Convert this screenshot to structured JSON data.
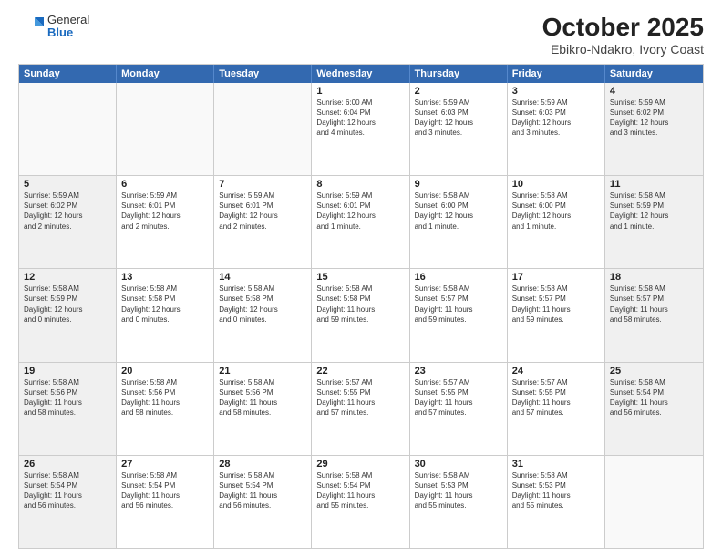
{
  "logo": {
    "general": "General",
    "blue": "Blue"
  },
  "title": "October 2025",
  "subtitle": "Ebikro-Ndakro, Ivory Coast",
  "header_days": [
    "Sunday",
    "Monday",
    "Tuesday",
    "Wednesday",
    "Thursday",
    "Friday",
    "Saturday"
  ],
  "weeks": [
    {
      "cells": [
        {
          "day": "",
          "empty": true
        },
        {
          "day": "",
          "empty": true
        },
        {
          "day": "",
          "empty": true
        },
        {
          "day": "1",
          "info": "Sunrise: 6:00 AM\nSunset: 6:04 PM\nDaylight: 12 hours\nand 4 minutes."
        },
        {
          "day": "2",
          "info": "Sunrise: 5:59 AM\nSunset: 6:03 PM\nDaylight: 12 hours\nand 3 minutes."
        },
        {
          "day": "3",
          "info": "Sunrise: 5:59 AM\nSunset: 6:03 PM\nDaylight: 12 hours\nand 3 minutes."
        },
        {
          "day": "4",
          "info": "Sunrise: 5:59 AM\nSunset: 6:02 PM\nDaylight: 12 hours\nand 3 minutes."
        }
      ]
    },
    {
      "cells": [
        {
          "day": "5",
          "info": "Sunrise: 5:59 AM\nSunset: 6:02 PM\nDaylight: 12 hours\nand 2 minutes."
        },
        {
          "day": "6",
          "info": "Sunrise: 5:59 AM\nSunset: 6:01 PM\nDaylight: 12 hours\nand 2 minutes."
        },
        {
          "day": "7",
          "info": "Sunrise: 5:59 AM\nSunset: 6:01 PM\nDaylight: 12 hours\nand 2 minutes."
        },
        {
          "day": "8",
          "info": "Sunrise: 5:59 AM\nSunset: 6:01 PM\nDaylight: 12 hours\nand 1 minute."
        },
        {
          "day": "9",
          "info": "Sunrise: 5:58 AM\nSunset: 6:00 PM\nDaylight: 12 hours\nand 1 minute."
        },
        {
          "day": "10",
          "info": "Sunrise: 5:58 AM\nSunset: 6:00 PM\nDaylight: 12 hours\nand 1 minute."
        },
        {
          "day": "11",
          "info": "Sunrise: 5:58 AM\nSunset: 5:59 PM\nDaylight: 12 hours\nand 1 minute."
        }
      ]
    },
    {
      "cells": [
        {
          "day": "12",
          "info": "Sunrise: 5:58 AM\nSunset: 5:59 PM\nDaylight: 12 hours\nand 0 minutes."
        },
        {
          "day": "13",
          "info": "Sunrise: 5:58 AM\nSunset: 5:58 PM\nDaylight: 12 hours\nand 0 minutes."
        },
        {
          "day": "14",
          "info": "Sunrise: 5:58 AM\nSunset: 5:58 PM\nDaylight: 12 hours\nand 0 minutes."
        },
        {
          "day": "15",
          "info": "Sunrise: 5:58 AM\nSunset: 5:58 PM\nDaylight: 11 hours\nand 59 minutes."
        },
        {
          "day": "16",
          "info": "Sunrise: 5:58 AM\nSunset: 5:57 PM\nDaylight: 11 hours\nand 59 minutes."
        },
        {
          "day": "17",
          "info": "Sunrise: 5:58 AM\nSunset: 5:57 PM\nDaylight: 11 hours\nand 59 minutes."
        },
        {
          "day": "18",
          "info": "Sunrise: 5:58 AM\nSunset: 5:57 PM\nDaylight: 11 hours\nand 58 minutes."
        }
      ]
    },
    {
      "cells": [
        {
          "day": "19",
          "info": "Sunrise: 5:58 AM\nSunset: 5:56 PM\nDaylight: 11 hours\nand 58 minutes."
        },
        {
          "day": "20",
          "info": "Sunrise: 5:58 AM\nSunset: 5:56 PM\nDaylight: 11 hours\nand 58 minutes."
        },
        {
          "day": "21",
          "info": "Sunrise: 5:58 AM\nSunset: 5:56 PM\nDaylight: 11 hours\nand 58 minutes."
        },
        {
          "day": "22",
          "info": "Sunrise: 5:57 AM\nSunset: 5:55 PM\nDaylight: 11 hours\nand 57 minutes."
        },
        {
          "day": "23",
          "info": "Sunrise: 5:57 AM\nSunset: 5:55 PM\nDaylight: 11 hours\nand 57 minutes."
        },
        {
          "day": "24",
          "info": "Sunrise: 5:57 AM\nSunset: 5:55 PM\nDaylight: 11 hours\nand 57 minutes."
        },
        {
          "day": "25",
          "info": "Sunrise: 5:58 AM\nSunset: 5:54 PM\nDaylight: 11 hours\nand 56 minutes."
        }
      ]
    },
    {
      "cells": [
        {
          "day": "26",
          "info": "Sunrise: 5:58 AM\nSunset: 5:54 PM\nDaylight: 11 hours\nand 56 minutes."
        },
        {
          "day": "27",
          "info": "Sunrise: 5:58 AM\nSunset: 5:54 PM\nDaylight: 11 hours\nand 56 minutes."
        },
        {
          "day": "28",
          "info": "Sunrise: 5:58 AM\nSunset: 5:54 PM\nDaylight: 11 hours\nand 56 minutes."
        },
        {
          "day": "29",
          "info": "Sunrise: 5:58 AM\nSunset: 5:54 PM\nDaylight: 11 hours\nand 55 minutes."
        },
        {
          "day": "30",
          "info": "Sunrise: 5:58 AM\nSunset: 5:53 PM\nDaylight: 11 hours\nand 55 minutes."
        },
        {
          "day": "31",
          "info": "Sunrise: 5:58 AM\nSunset: 5:53 PM\nDaylight: 11 hours\nand 55 minutes."
        },
        {
          "day": "",
          "empty": true
        }
      ]
    }
  ]
}
